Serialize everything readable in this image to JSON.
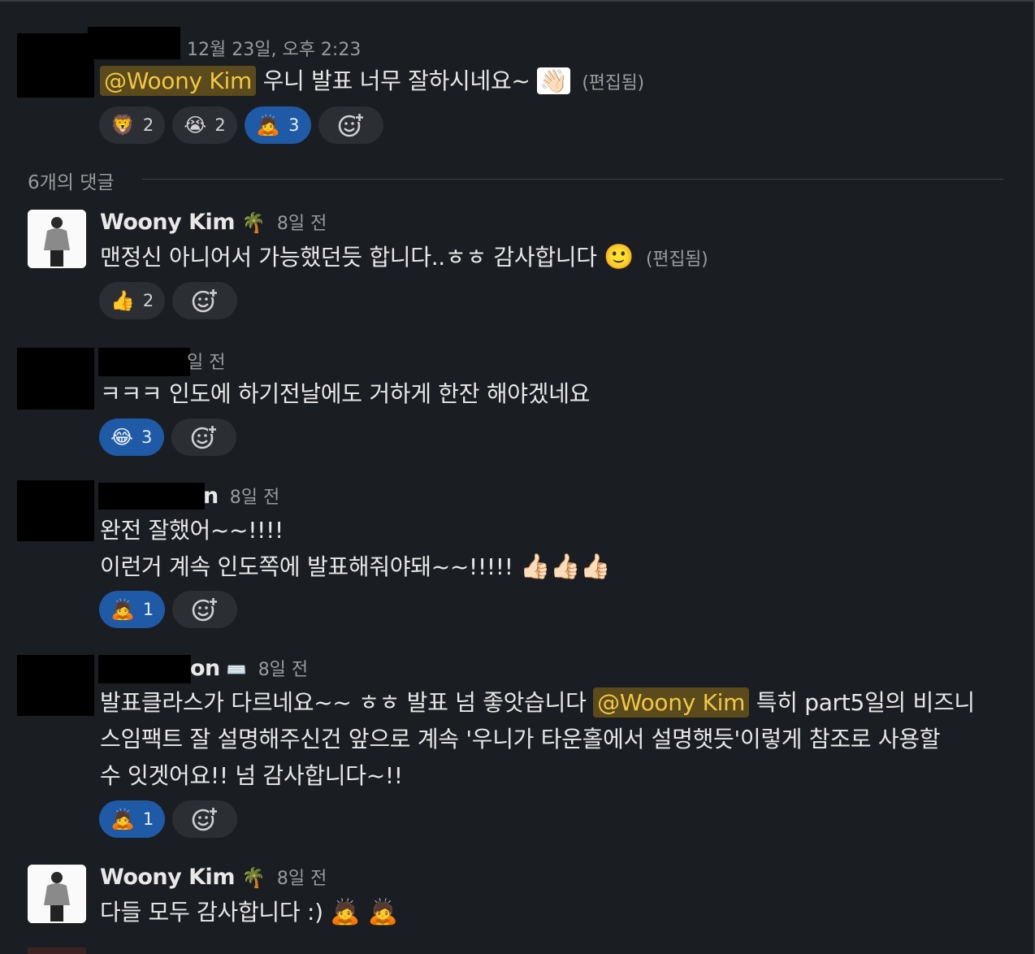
{
  "messages": [
    {
      "time": "12월 23일, 오후 2:23",
      "mention": "@Woony Kim",
      "text": "우니 발표 너무 잘하시네요~",
      "text_emoji": "👋🏻",
      "edited": "(편집됨)",
      "reactions": [
        {
          "emoji": "🦁",
          "count": "2"
        },
        {
          "emoji": "😭",
          "count": "2"
        },
        {
          "emoji": "🙇",
          "count": "3"
        }
      ]
    },
    {
      "author": "Woony Kim",
      "status_emoji": "🌴",
      "time": "8일 전",
      "text": "맨정신 아니어서 가능했던듯 합니다..ㅎㅎ 감사합니다",
      "text_emoji": "🙂",
      "edited": "(편집됨)",
      "reactions": [
        {
          "emoji": "👍",
          "count": "2"
        }
      ]
    },
    {
      "time": "일 전",
      "text": "ㅋㅋㅋ 인도에 하기전날에도 거하게 한잔 해야겠네요",
      "reactions": [
        {
          "emoji": "😂",
          "count": "3"
        }
      ]
    },
    {
      "author_fragment": "n",
      "time": "8일 전",
      "line1": "완전 잘했어~~!!!!",
      "line2": "이런거 계속 인도쪽에 발표해줘야돼~~!!!!!",
      "line2_emoji": "👍🏻👍🏻👍🏻",
      "reactions": [
        {
          "emoji": "🙇",
          "count": "1"
        }
      ]
    },
    {
      "author_fragment": "on",
      "status_emoji": "⌨️",
      "time": "8일 전",
      "pre": "발표클라스가 다르네요~~ ㅎㅎ 발표 넘 좋앗습니다",
      "mention": "@Woony Kim",
      "post": "특히 part5일의 비즈니",
      "line2": "스임팩트 잘 설명해주신건 앞으로 계속 '우니가 타운홀에서 설명햇듯'이렇게 참조로 사용할",
      "line3": "수 잇겟어요!! 넘 감사합니다~!!",
      "reactions": [
        {
          "emoji": "🙇",
          "count": "1"
        }
      ]
    },
    {
      "author": "Woony Kim",
      "status_emoji": "🌴",
      "time": "8일 전",
      "text": "다들 모두 감사합니다 :)",
      "text_emoji": "🙇 🙇"
    }
  ],
  "thread_divider": "6개의 댓글",
  "add_reaction_icon": "add-reaction-icon"
}
